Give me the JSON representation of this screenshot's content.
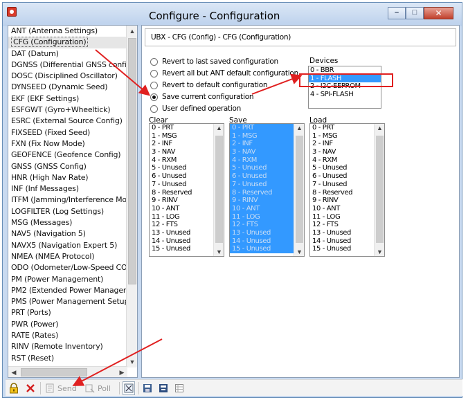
{
  "window": {
    "title": "Configure - Configuration",
    "buttons": {
      "minimize": "–",
      "maximize": "□",
      "close": "✕"
    }
  },
  "sidebar": {
    "selected_index": 1,
    "items": [
      "ANT (Antenna Settings)",
      "CFG (Configuration)",
      "DAT (Datum)",
      "DGNSS (Differential GNSS confi",
      "DOSC (Disciplined Oscillator)",
      "DYNSEED (Dynamic Seed)",
      "EKF (EKF Settings)",
      "ESFGWT (Gyro+Wheeltick)",
      "ESRC (External Source Config)",
      "FIXSEED (Fixed Seed)",
      "FXN (Fix Now Mode)",
      "GEOFENCE (Geofence Config)",
      "GNSS (GNSS Config)",
      "HNR (High Nav Rate)",
      "INF (Inf Messages)",
      "ITFM (Jamming/Interference Mo",
      "LOGFILTER (Log Settings)",
      "MSG (Messages)",
      "NAV5 (Navigation 5)",
      "NAVX5 (Navigation Expert 5)",
      "NMEA (NMEA Protocol)",
      "ODO (Odometer/Low-Speed CO",
      "PM (Power Management)",
      "PM2 (Extended Power Manager",
      "PMS (Power Management Setup",
      "PRT (Ports)",
      "PWR (Power)",
      "RATE (Rates)",
      "RINV (Remote Inventory)",
      "RST (Reset)"
    ]
  },
  "header": {
    "text": "UBX - CFG (Config) - CFG (Configuration)"
  },
  "options": {
    "selected_index": 3,
    "items": [
      "Revert to last saved configuration",
      "Revert all but ANT default configuration",
      "Revert to default configuration",
      "Save current configuration",
      "User defined operation"
    ]
  },
  "devices": {
    "label": "Devices",
    "selected_index": 1,
    "items": [
      "0 - BBR",
      "1 - FLASH",
      "2 - I2C-EEPROM",
      "4 - SPI-FLASH"
    ]
  },
  "lists": {
    "clear_label": "Clear",
    "save_label": "Save",
    "load_label": "Load",
    "items": [
      "0 - PRT",
      "1 - MSG",
      "2 - INF",
      "3 - NAV",
      "4 - RXM",
      "5 - Unused",
      "6 - Unused",
      "7 - Unused",
      "8 - Reserved",
      "9 - RINV",
      "10 - ANT",
      "11 - LOG",
      "12 - FTS",
      "13 - Unused",
      "14 - Unused",
      "15 - Unused"
    ]
  },
  "toolbar": {
    "send": "Send",
    "poll": "Poll"
  },
  "colors": {
    "selection": "#3399ff",
    "annotation": "#e02020"
  }
}
